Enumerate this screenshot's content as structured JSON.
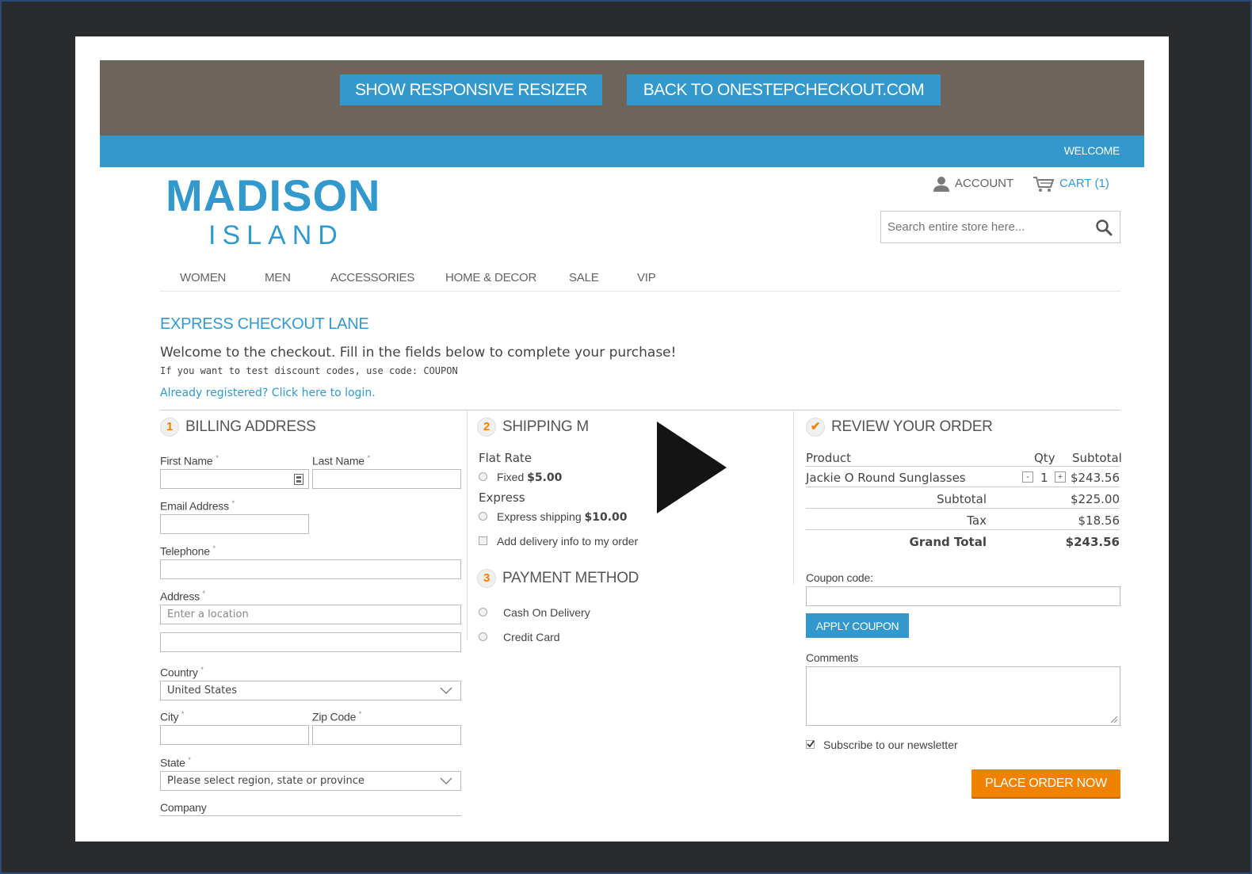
{
  "banner": {
    "resizer_label": "SHOW RESPONSIVE RESIZER",
    "back_label": "BACK TO ONESTEPCHECKOUT.COM"
  },
  "topbar": {
    "welcome": "WELCOME"
  },
  "logo": {
    "main": "MADISON",
    "sub": "ISLAND"
  },
  "header": {
    "account": "ACCOUNT",
    "cart": "CART (1)",
    "search_placeholder": "Search entire store here..."
  },
  "nav": [
    "WOMEN",
    "MEN",
    "ACCESSORIES",
    "HOME & DECOR",
    "SALE",
    "VIP"
  ],
  "checkout": {
    "title": "EXPRESS CHECKOUT LANE",
    "welcome": "Welcome to the checkout. Fill in the fields below to complete your purchase!",
    "hint": "If you want to test discount codes, use code: COUPON",
    "login": "Already registered? Click here to login."
  },
  "billing": {
    "num": "1",
    "title": "BILLING ADDRESS",
    "first_name": "First Name",
    "last_name": "Last Name",
    "email": "Email Address",
    "telephone": "Telephone",
    "address": "Address",
    "address_placeholder": "Enter a location",
    "country": "Country",
    "country_value": "United States",
    "city": "City",
    "zip": "Zip Code",
    "state": "State",
    "state_value": "Please select region, state or province",
    "company": "Company",
    "required": "*"
  },
  "shipping": {
    "num": "2",
    "title": "SHIPPING M",
    "flat_rate": "Flat Rate",
    "fixed": "Fixed",
    "fixed_price": "$5.00",
    "express": "Express",
    "express_shipping": "Express shipping",
    "express_price": "$10.00",
    "delivery_info": "Add delivery info to my order"
  },
  "payment": {
    "num": "3",
    "title": "PAYMENT METHOD",
    "cod": "Cash On Delivery",
    "card": "Credit Card"
  },
  "review": {
    "title": "REVIEW YOUR ORDER",
    "col_product": "Product",
    "col_qty": "Qty",
    "col_subtotal": "Subtotal",
    "item_name": "Jackie O Round Sunglasses",
    "item_qty": "1",
    "item_total": "$243.56",
    "minus": "-",
    "plus": "+",
    "subtotal_label": "Subtotal",
    "subtotal_value": "$225.00",
    "tax_label": "Tax",
    "tax_value": "$18.56",
    "grand_label": "Grand Total",
    "grand_value": "$243.56",
    "coupon_label": "Coupon code:",
    "apply": "APPLY COUPON",
    "comments_label": "Comments",
    "newsletter": "Subscribe to our newsletter",
    "place_order": "PLACE ORDER NOW"
  },
  "colors": {
    "accent": "#3399cc",
    "banner": "#6d645b",
    "orange": "#f18200",
    "backdrop": "#2a2b2d"
  }
}
